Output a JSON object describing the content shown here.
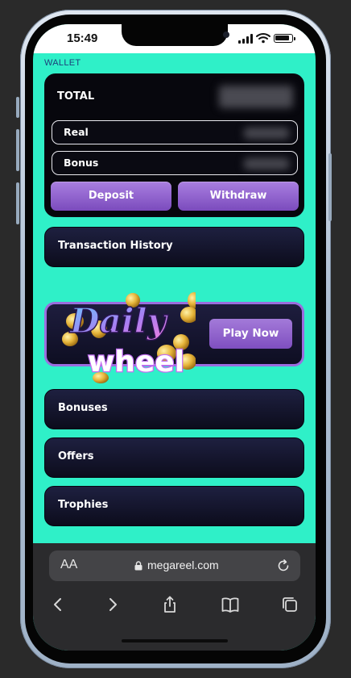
{
  "status_bar": {
    "time": "15:49"
  },
  "wallet": {
    "section_label": "WALLET",
    "total_label": "TOTAL",
    "real_label": "Real",
    "bonus_label": "Bonus",
    "deposit_label": "Deposit",
    "withdraw_label": "Withdraw"
  },
  "menu": {
    "transaction_history": "Transaction History",
    "bonuses": "Bonuses",
    "offers": "Offers",
    "trophies": "Trophies"
  },
  "daily_wheel": {
    "logo_text_1": "Daily",
    "logo_text_2": "wheel",
    "play_label": "Play Now"
  },
  "browser": {
    "text_size_icon": "AA",
    "url": "megareel.com"
  },
  "icons": {
    "lock": "lock-icon",
    "reload": "reload-icon",
    "back": "chevron-left-icon",
    "forward": "chevron-right-icon",
    "share": "share-icon",
    "bookmarks": "book-icon",
    "tabs": "tabs-icon"
  },
  "colors": {
    "page_bg": "#2ff0c8",
    "card_bg": "#07070d",
    "button_purple": "#8c5ccc",
    "browser_bg": "#2b2b2d"
  }
}
